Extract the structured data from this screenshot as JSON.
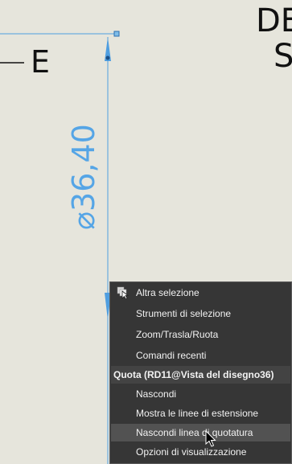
{
  "drawing": {
    "title_line1": "DE",
    "title_line2": "S",
    "section_label": "E",
    "dimension_text": "⌀36,40",
    "dimension_color": "#55a5e6"
  },
  "context_menu": {
    "items_top": [
      {
        "label": "Altra selezione",
        "icon": "select-other-icon"
      },
      {
        "label": "Strumenti di selezione"
      },
      {
        "label": "Zoom/Trasla/Ruota"
      },
      {
        "label": "Comandi recenti"
      }
    ],
    "section_header": "Quota (RD11@Vista del disegno36)",
    "items_bottom": [
      {
        "label": "Nascondi"
      },
      {
        "label": "Mostra le linee di estensione"
      },
      {
        "label": "Nascondi linea di quotatura",
        "highlighted": true
      },
      {
        "label": "Opzioni di visualizzazione"
      }
    ],
    "colors": {
      "background": "#363636",
      "highlight": "#525252",
      "header": "#434343"
    }
  }
}
